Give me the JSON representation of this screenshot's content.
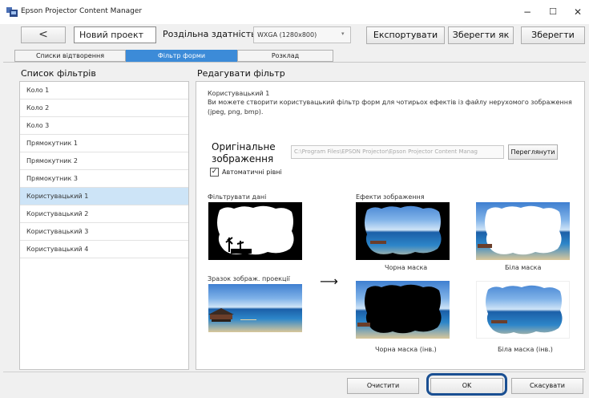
{
  "window": {
    "title": "Epson Projector Content Manager",
    "minimize": "−",
    "maximize": "☐",
    "close": "✕"
  },
  "toolbar": {
    "back": "<",
    "project_name": "Новий проект",
    "resolution_label": "Роздільна здатність :",
    "resolution_value": "WXGA (1280x800)",
    "export": "Експортувати",
    "save_as": "Зберегти як",
    "save": "Зберегти"
  },
  "tabs": [
    {
      "label": "Списки відтворення",
      "active": false
    },
    {
      "label": "Фільтр форми",
      "active": true
    },
    {
      "label": "Розклад",
      "active": false
    }
  ],
  "filter_list": {
    "title": "Список фільтрів",
    "items": [
      "Коло 1",
      "Коло 2",
      "Коло 3",
      "Прямокутник 1",
      "Прямокутник 2",
      "Прямокутник 3",
      "Користувацький 1",
      "Користувацький 2",
      "Користувацький 3",
      "Користувацький 4"
    ],
    "selected_index": 6
  },
  "editor": {
    "title": "Редагувати фільтр",
    "filter_name": "Користувацький 1",
    "description": "Ви можете створити користувацький фільтр форм для чотирьох ефектів із файлу нерухомого зображення (jpeg, png, bmp).",
    "original_image_label": "Оригінальне зображення",
    "path_value": "C:\\Program Files\\EPSON Projector\\Epson Projector Content Manag",
    "browse": "Переглянути",
    "auto_levels": "Автоматичні рівні",
    "auto_levels_checked": true,
    "filter_data_label": "Фільтрувати дані",
    "preview_label": "Зразок зображ. проекції",
    "effects_label": "Ефекти зображення",
    "arrow": "⟶",
    "effects": {
      "black_mask": "Чорна маска",
      "white_mask": "Біла маска",
      "black_mask_inv": "Чорна маска (інв.)",
      "white_mask_inv": "Біла маска (інв.)"
    }
  },
  "footer": {
    "clear": "Очистити",
    "ok": "OK",
    "cancel": "Скасувати"
  }
}
